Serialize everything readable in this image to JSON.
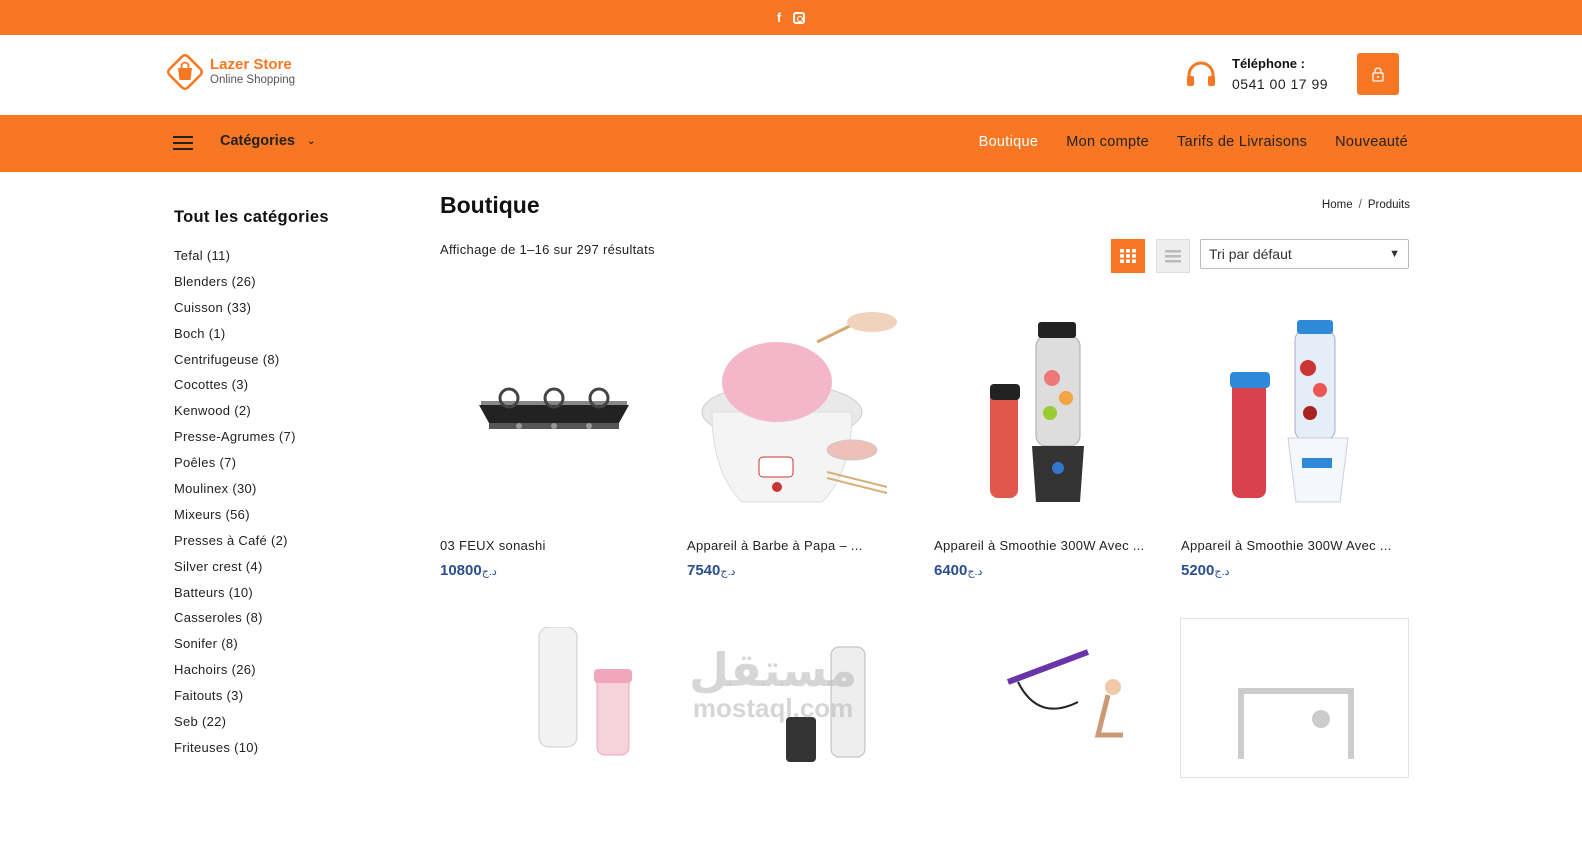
{
  "topbar": {
    "social": [
      "facebook-icon",
      "instagram-icon"
    ]
  },
  "brand": {
    "name": "Lazer Store",
    "tagline": "Online Shopping",
    "accent": "#f87722"
  },
  "contact": {
    "label": "Téléphone :",
    "number": "0541 00 17 99"
  },
  "nav": {
    "categories_label": "Catégories",
    "menu": [
      "Boutique",
      "Mon compte",
      "Tarifs de Livraisons",
      "Nouveauté"
    ],
    "active": "Boutique"
  },
  "sidebar": {
    "title": "Tout les catégories",
    "items": [
      "Tefal (11)",
      "Blenders (26)",
      "Cuisson (33)",
      "Boch (1)",
      "Centrifugeuse (8)",
      "Cocottes (3)",
      "Kenwood (2)",
      "Presse-Agrumes (7)",
      "Poêles (7)",
      "Moulinex (30)",
      "Mixeurs (56)",
      "Presses à Café (2)",
      "Silver crest (4)",
      "Batteurs (10)",
      "Casseroles (8)",
      "Sonifer (8)",
      "Hachoirs (26)",
      "Faitouts (3)",
      "Seb (22)",
      "Friteuses (10)"
    ]
  },
  "main": {
    "title": "Boutique",
    "breadcrumb": [
      "Home",
      "Produits"
    ],
    "result_count": "Affichage de 1–16 sur 297 résultats",
    "sort_selected": "Tri par défaut"
  },
  "currency": "د.ج",
  "products": [
    {
      "name": "03 FEUX sonashi",
      "price": "10800"
    },
    {
      "name": "Appareil à Barbe à Papa – ...",
      "price": "7540"
    },
    {
      "name": "Appareil à Smoothie 300W Avec ...",
      "price": "6400"
    },
    {
      "name": "Appareil à Smoothie 300W Avec ...",
      "price": "5200"
    }
  ],
  "watermark": {
    "ar": "مستقل",
    "en": "mostaql.com"
  }
}
